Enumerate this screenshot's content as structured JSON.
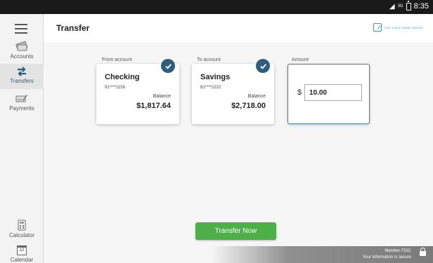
{
  "status_bar": {
    "network": "3G",
    "time": "8:35"
  },
  "sidebar": {
    "items": [
      {
        "label": "Accounts"
      },
      {
        "label": "Transfers"
      },
      {
        "label": "Payments"
      },
      {
        "label": "Calculator"
      },
      {
        "label": "Calendar",
        "day": "12"
      }
    ]
  },
  "header": {
    "title": "Transfer",
    "logo_text": "THE STATE BANK GROUP"
  },
  "from": {
    "label": "From account",
    "name": "Checking",
    "number": "91****1156",
    "balance_label": "Balance",
    "balance": "$1,817.64"
  },
  "to": {
    "label": "To account",
    "name": "Savings",
    "number": "81****2222",
    "balance_label": "Balance",
    "balance": "$2,718.00"
  },
  "amount": {
    "label": "Amount",
    "currency": "$",
    "value": "10.00"
  },
  "actions": {
    "transfer_label": "Transfer Now"
  },
  "footer": {
    "line1": "Member FDIC",
    "line2": "Your information is secure"
  },
  "colors": {
    "accent": "#2e5d82",
    "button": "#4caf48"
  }
}
